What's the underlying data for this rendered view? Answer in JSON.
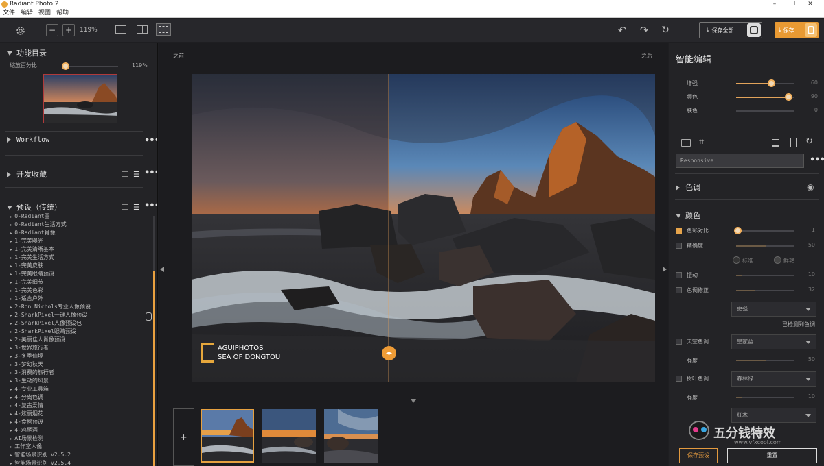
{
  "app": {
    "title": "Radiant Photo 2"
  },
  "menu": [
    "文件",
    "编辑",
    "视图",
    "帮助"
  ],
  "toolbar": {
    "zoom": "119%",
    "save_all": "保存全部",
    "save": "保存"
  },
  "left": {
    "catalog_title": "功能目录",
    "zoom_label": "缩放百分比",
    "zoom_value": "119%",
    "zoom_fraction": 0.0,
    "workflow": "Workflow",
    "dev_favorites": "开发收藏",
    "presets_title": "预设（传统）",
    "presets": [
      "0-Radiant圖",
      "0-Radiant生活方式",
      "0-Radiant肖像",
      "1-完美曝光",
      "1-完美清晰基本",
      "1-完美生活方式",
      "1-完美皮肤",
      "1-完美眼睛预设",
      "1-完美细节",
      "1-完美色彩",
      "1-适合户外",
      "2-Ron Nichols专业人像预设",
      "2-SharkPixel一键人像预设",
      "2-SharkPixel人像预设包",
      "2-SharkPixel眼睛预设",
      "2-美丽佳人肖像预设",
      "3-世界旅行者",
      "3-冬季仙境",
      "3-梦幻秋天",
      "3-消费的旅行者",
      "3-生动的风景",
      "4-专业工具箱",
      "4-分离色调",
      "4-复古爱情",
      "4-炫丽烟花",
      "4-食物预设",
      "4-鸡尾酒",
      "AI场景检测",
      "工作室人像",
      "智能场景识别 v2.5.2",
      "智能场景识别 v2.5.4"
    ]
  },
  "center": {
    "before_label": "之前",
    "after_label": "之后",
    "watermark_line1": "AGUIPHOTOS",
    "watermark_line2": "SEA OF DONGTOU",
    "add_label": "+"
  },
  "right": {
    "title": "智能编辑",
    "sliders": [
      {
        "label": "增强",
        "value": 60
      },
      {
        "label": "颜色",
        "value": 90
      },
      {
        "label": "肤色",
        "value": 0
      }
    ],
    "profile": "Responsive",
    "tone_title": "色调",
    "color_title": "颜色",
    "color_rows": [
      {
        "label": "色彩对比",
        "value": 1,
        "checked": true
      },
      {
        "label": "精确度",
        "value": 50,
        "checked": false
      }
    ],
    "radio_standard": "标准",
    "radio_vivid": "鲜艳",
    "vibrance": {
      "label": "振动",
      "value": 10
    },
    "cast": {
      "label": "色调修正",
      "value": 32
    },
    "cast_select": "更强",
    "cast_detected": "已检测到色调",
    "sky": {
      "label": "天空色调",
      "select": "皇家蓝"
    },
    "sky_strength": {
      "label": "强度",
      "value": 50
    },
    "foliage": {
      "label": "树叶色调",
      "select": "森林绿"
    },
    "foliage_strength": {
      "label": "强度",
      "value": 10
    },
    "foliage_select2": "红木",
    "save_preset": "保存预设",
    "reset": "重置",
    "brand_text": "五分钱特效",
    "brand_url": "www.vfxcool.com"
  }
}
